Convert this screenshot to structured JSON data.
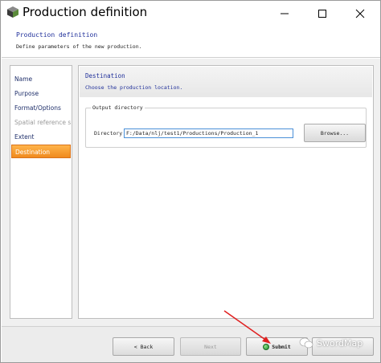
{
  "window": {
    "title": "Production definition",
    "icon": "cube-icon"
  },
  "header": {
    "title": "Production definition",
    "subtitle": "Define parameters of the new production."
  },
  "nav": {
    "items": [
      {
        "label": "Name",
        "state": "normal"
      },
      {
        "label": "Purpose",
        "state": "normal"
      },
      {
        "label": "Format/Options",
        "state": "normal"
      },
      {
        "label": "Spatial reference s",
        "state": "disabled"
      },
      {
        "label": "Extent",
        "state": "normal"
      },
      {
        "label": "Destination",
        "state": "active"
      }
    ]
  },
  "panel": {
    "title": "Destination",
    "subtitle": "Choose the production location.",
    "group_label": "Output directory",
    "directory_label": "Directory",
    "directory_value": "F:/Data/nlj/test1/Productions/Production_1",
    "browse_label": "Browse..."
  },
  "footer": {
    "back_label": "< Back",
    "next_label": "Next",
    "submit_label": "Submit",
    "submit_icon": "green-check-icon"
  },
  "watermark": {
    "text": "SwordMap"
  },
  "colors": {
    "accent_orange": "#f08a1e",
    "header_blue": "#1f2f9a",
    "input_border": "#4a8fd8",
    "annotation_arrow": "#e02020"
  }
}
